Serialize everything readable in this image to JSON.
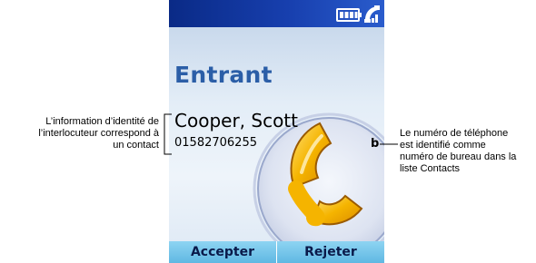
{
  "status_bar": {
    "icons": [
      "battery-icon",
      "phone-signal-icon"
    ],
    "colors": {
      "bar": "#173fae"
    }
  },
  "screen": {
    "title": "Entrant",
    "caller": {
      "name": "Cooper, Scott",
      "number": "01582706255",
      "type_badge": "b"
    },
    "graphic_icon": "phone-handset-icon",
    "colors": {
      "title": "#2b5ea7",
      "handset": "#f5b400"
    }
  },
  "softkeys": {
    "left_label": "Accepter",
    "right_label": "Rejeter"
  },
  "annotations": {
    "left": [
      "L’information d’identité de",
      "l’interlocuteur correspond à",
      "un contact"
    ],
    "right": [
      "Le numéro de téléphone",
      "est identifié comme",
      "numéro de bureau dans la",
      "liste Contacts"
    ]
  }
}
